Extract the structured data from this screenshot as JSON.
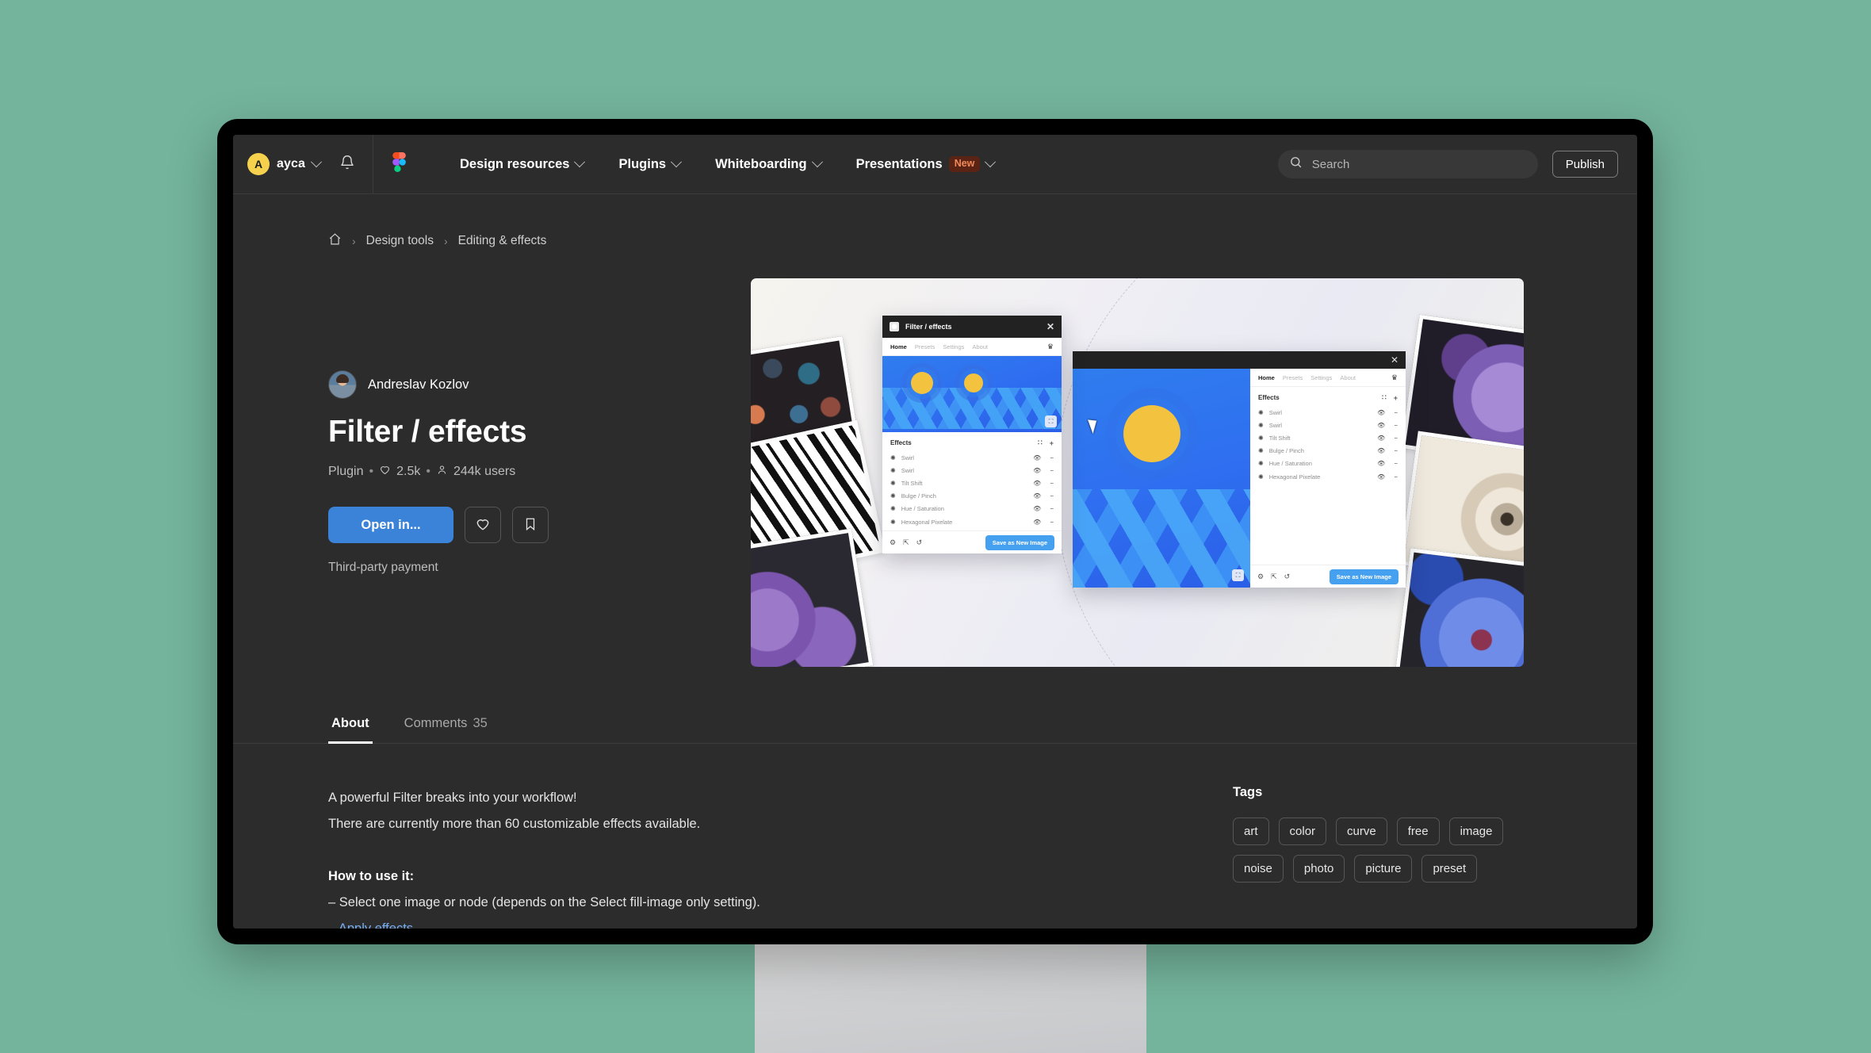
{
  "topnav": {
    "user": {
      "initial": "A",
      "name": "ayca"
    },
    "icons": {
      "bell": "bell-icon",
      "logo": "figma-logo-icon",
      "search": "search-icon"
    },
    "items": [
      {
        "label": "Design resources",
        "badge": null
      },
      {
        "label": "Plugins",
        "badge": null
      },
      {
        "label": "Whiteboarding",
        "badge": null
      },
      {
        "label": "Presentations",
        "badge": "New"
      }
    ],
    "search": {
      "placeholder": "Search",
      "value": ""
    },
    "publish_label": "Publish"
  },
  "breadcrumb": {
    "home_icon": "home-icon",
    "items": [
      "Design tools",
      "Editing & effects"
    ],
    "separator": "›"
  },
  "hero": {
    "author": "Andreslav Kozlov",
    "title": "Filter / effects",
    "meta": {
      "type": "Plugin",
      "likes": "2.5k",
      "users": "244k users",
      "sep": "•"
    },
    "open_label": "Open in...",
    "like_icon": "heart-icon",
    "save_icon": "bookmark-icon",
    "payment_note": "Third-party payment"
  },
  "preview": {
    "plugin_window": {
      "title": "Filter / effects",
      "close_icon": "close-icon",
      "tabs": [
        "Home",
        "Presets",
        "Settings",
        "About"
      ],
      "active_tab": "Home",
      "crown_icon": "crown-icon",
      "effects_label": "Effects",
      "drag_icon": "drag-handle-icon",
      "add_icon": "plus-icon",
      "effects": [
        "Swirl",
        "Swirl",
        "Tilt Shift",
        "Bulge / Pinch",
        "Hue / Saturation",
        "Hexagonal Pixelate"
      ],
      "row_icons": {
        "effect": "effect-star-icon",
        "visibility": "eye-icon",
        "remove": "minus-icon"
      },
      "footer_icons": [
        "gear-icon",
        "export-icon",
        "reset-icon"
      ],
      "save_label": "Save as New Image",
      "expand_icon": "expand-icon"
    },
    "cursor_icon": "mouse-cursor-icon"
  },
  "tabs": [
    {
      "label": "About",
      "count": null,
      "active": true
    },
    {
      "label": "Comments",
      "count": "35",
      "active": false
    }
  ],
  "about": {
    "lines": [
      "A powerful Filter breaks into your workflow!",
      "There are currently more than 60 customizable effects available."
    ],
    "heading": "How to use it:",
    "step1": "– Select one image or node (depends on the Select fill-image only setting).",
    "step2_prefix": "– ",
    "step2_link": "Apply effects",
    "step2_suffix": "."
  },
  "tags": {
    "title": "Tags",
    "items": [
      "art",
      "color",
      "curve",
      "free",
      "image",
      "noise",
      "photo",
      "picture",
      "preset"
    ]
  },
  "colors": {
    "background": "#74b49c",
    "screen_bg": "#2c2c2c",
    "accent_blue": "#3b82d9",
    "badge_new_bg": "#5a2314",
    "badge_new_text": "#f1895a",
    "avatar_yellow": "#f5d14e",
    "link_blue": "#77aef2"
  }
}
